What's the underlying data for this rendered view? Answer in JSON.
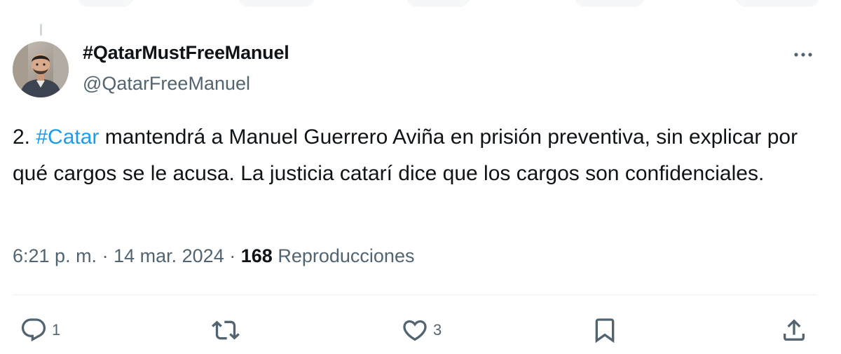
{
  "author": {
    "display_name": "#QatarMustFreeManuel",
    "handle": "@QatarFreeManuel",
    "avatar_icon": "person-avatar"
  },
  "tweet": {
    "segments": [
      {
        "text": "2. ",
        "type": "text"
      },
      {
        "text": "#Catar",
        "type": "hashtag"
      },
      {
        "text": " mantendrá a Manuel Guerrero Aviña en prisión preventiva, sin explicar por qué cargos se le acusa. La justicia catarí dice que los cargos son confidenciales.",
        "type": "text"
      }
    ]
  },
  "meta": {
    "time": "6:21 p. m.",
    "separator": "·",
    "date": "14 mar. 2024",
    "views_count": "168",
    "views_label": "Reproducciones"
  },
  "actions": {
    "reply_count": "1",
    "retweet_count": "",
    "like_count": "3"
  },
  "colors": {
    "text": "#0f1419",
    "secondary": "#536471",
    "link": "#1d9bf0",
    "divider": "#eff3f4"
  }
}
